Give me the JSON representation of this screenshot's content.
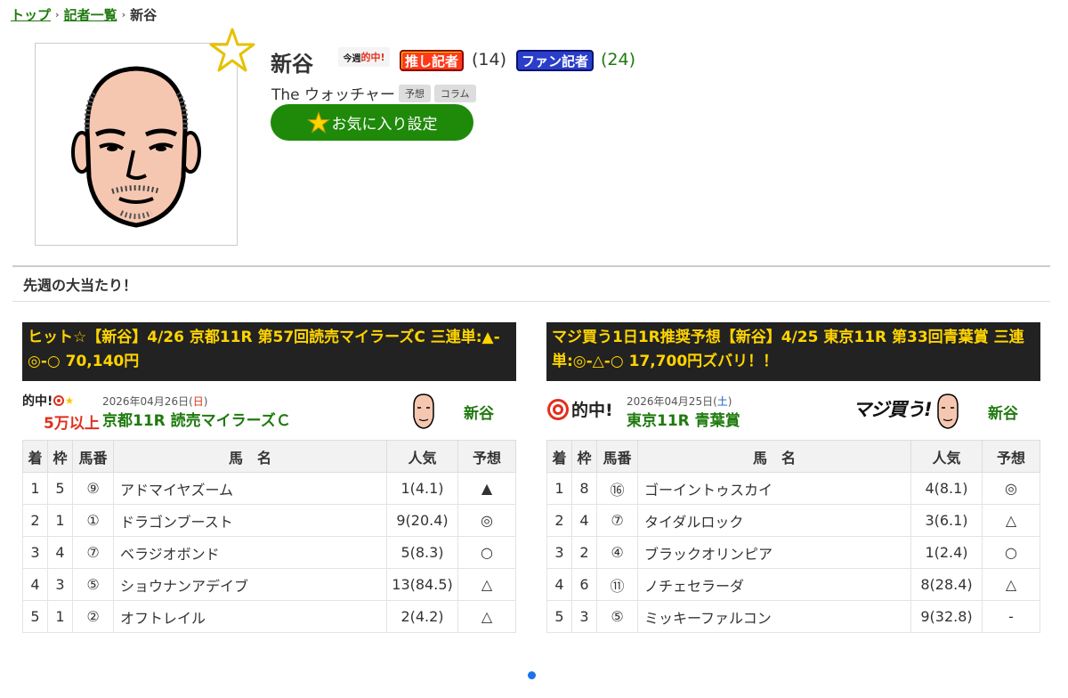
{
  "breadcrumb": {
    "top": "トップ",
    "list": "記者一覧",
    "current": "新谷"
  },
  "profile": {
    "name": "新谷",
    "hit_badge_prefix": "今週",
    "hit_badge": "的中!",
    "oshi_label": "推し記者",
    "oshi_count": "(14)",
    "fan_label": "ファン記者",
    "fan_count": "(24)",
    "subtitle": "The ウォッチャー",
    "tags": [
      "予想",
      "コラム"
    ],
    "fav_button": "お気に入り設定"
  },
  "section_title": "先週の大当たり！",
  "cards": [
    {
      "headline": "ヒット☆【新谷】4/26 京都11R 第57回読売マイラーズC 三連単:▲-◎-○ 70,140円",
      "logo_text_1": "的中!",
      "logo_text_2": "5万以上",
      "date_prefix": "2026年04月26日(",
      "date_day": "日",
      "date_suffix": ")",
      "race": "京都11R 読売マイラーズＣ",
      "writer": "新谷",
      "columns": [
        "着",
        "枠",
        "馬番",
        "馬　名",
        "人気",
        "予想"
      ],
      "rows": [
        [
          "1",
          "5",
          "⑨",
          "アドマイヤズーム",
          "1(4.1)",
          "▲"
        ],
        [
          "2",
          "1",
          "①",
          "ドラゴンブースト",
          "9(20.4)",
          "◎"
        ],
        [
          "3",
          "4",
          "⑦",
          "ベラジオボンド",
          "5(8.3)",
          "○"
        ],
        [
          "4",
          "3",
          "⑤",
          "ショウナンアデイブ",
          "13(84.5)",
          "△"
        ],
        [
          "5",
          "1",
          "②",
          "オフトレイル",
          "2(4.2)",
          "△"
        ]
      ]
    },
    {
      "headline": "マジ買う1日1R推奨予想【新谷】4/25 東京11R 第33回青葉賞 三連単:◎-△-○ 17,700円ズバリ！！",
      "logo_text_1": "的中!",
      "maji_text": "マジ買う!",
      "date_prefix": "2026年04月25日(",
      "date_day": "土",
      "date_suffix": ")",
      "race": "東京11R 青葉賞",
      "writer": "新谷",
      "columns": [
        "着",
        "枠",
        "馬番",
        "馬　名",
        "人気",
        "予想"
      ],
      "rows": [
        [
          "1",
          "8",
          "⑯",
          "ゴーイントゥスカイ",
          "4(8.1)",
          "◎"
        ],
        [
          "2",
          "4",
          "⑦",
          "タイダルロック",
          "3(6.1)",
          "△"
        ],
        [
          "3",
          "2",
          "④",
          "ブラックオリンピア",
          "1(2.4)",
          "○"
        ],
        [
          "4",
          "6",
          "⑪",
          "ノチェセラーダ",
          "8(28.4)",
          "△"
        ],
        [
          "5",
          "3",
          "⑤",
          "ミッキーファルコン",
          "9(32.8)",
          "-"
        ]
      ]
    }
  ]
}
